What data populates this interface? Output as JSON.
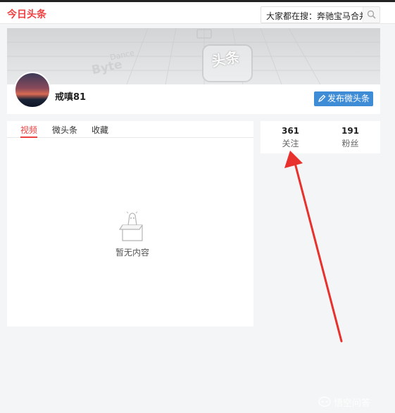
{
  "header": {
    "logo": "今日头条",
    "search_text": "大家都在搜：奔驰宝马合并"
  },
  "profile": {
    "username": "戒嗔81",
    "publish_label": "发布微头条",
    "banner_words": [
      "Dance",
      "Byte",
      "头条"
    ]
  },
  "tabs": [
    {
      "label": "视频",
      "active": true
    },
    {
      "label": "微头条",
      "active": false
    },
    {
      "label": "收藏",
      "active": false
    }
  ],
  "empty": {
    "text": "暂无内容"
  },
  "stats": [
    {
      "value": "361",
      "label": "关注"
    },
    {
      "value": "191",
      "label": "粉丝"
    }
  ],
  "colors": {
    "brand_red": "#ed4040",
    "button_blue": "#3e8bd6",
    "arrow_red": "#e8302c"
  },
  "watermark": {
    "text": "悟空问答"
  }
}
